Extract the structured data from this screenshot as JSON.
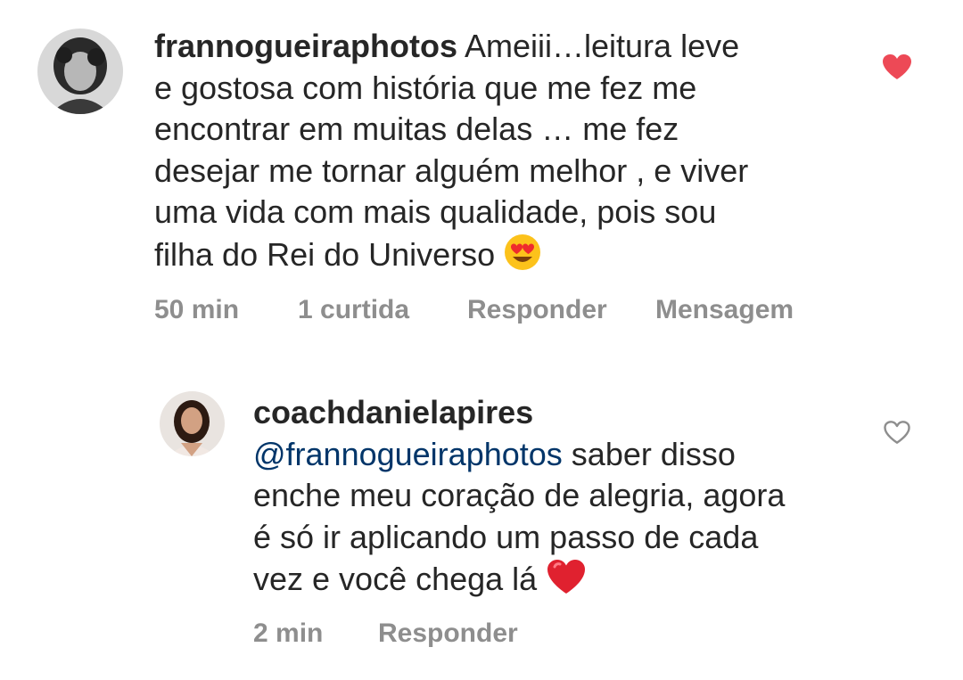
{
  "comments": [
    {
      "username": "frannogueiraphotos",
      "text_parts": [
        "Ameiii…leitura leve",
        "e gostosa com história que me fez me",
        "encontrar em muitas delas … me fez",
        "desejar me tornar alguém melhor , e viver",
        "uma vida com mais qualidade, pois sou",
        "filha do Rei do Universo"
      ],
      "emoji": "heart-eyes-emoji",
      "time": "50 min",
      "likes": "1 curtida",
      "reply_label": "Responder",
      "message_label": "Mensagem",
      "liked": true,
      "like_color": "#ed4956"
    },
    {
      "username": "coachdanielapires",
      "mention": "@frannogueiraphotos",
      "text_after_mention": "saber disso",
      "text_lines": [
        "enche meu coração de alegria, agora",
        "é só ir aplicando um passo de cada",
        "vez e você chega lá"
      ],
      "emoji": "red-heart-emoji",
      "time": "2 min",
      "reply_label": "Responder",
      "liked": false
    }
  ]
}
